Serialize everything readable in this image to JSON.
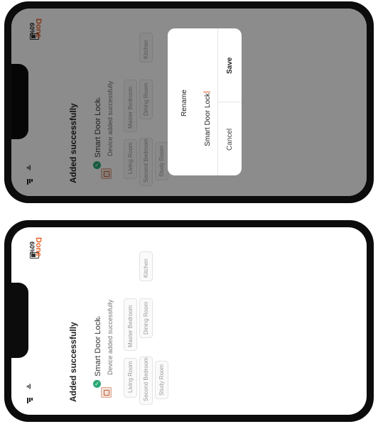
{
  "top_screen": {
    "status": {
      "battery": "60%"
    },
    "header": {
      "done_label": "Done",
      "title": "Added successfully"
    },
    "device": {
      "name": "Smart Door Lock",
      "status": "Device added successfully"
    },
    "rooms": [
      "Living Room",
      "Master Bedroom",
      "Kitchen",
      "Second Bedroom",
      "Dining Room",
      "Study Room"
    ],
    "dialog": {
      "title": "Rename",
      "input_value": "Smart Door Lock",
      "cancel_label": "Cancel",
      "save_label": "Save"
    }
  },
  "bottom_screen": {
    "status": {
      "battery": "60%"
    },
    "header": {
      "done_label": "Done",
      "title": "Added successfully"
    },
    "device": {
      "name": "Smart Door Lock",
      "status": "Device added successfully"
    },
    "rooms": [
      "Living Room",
      "Master Bedroom",
      "Kitchen",
      "Second Bedroom",
      "Dining Room",
      "Study Room"
    ]
  },
  "colors": {
    "accent": "#e8622a",
    "success": "#2aa876"
  }
}
